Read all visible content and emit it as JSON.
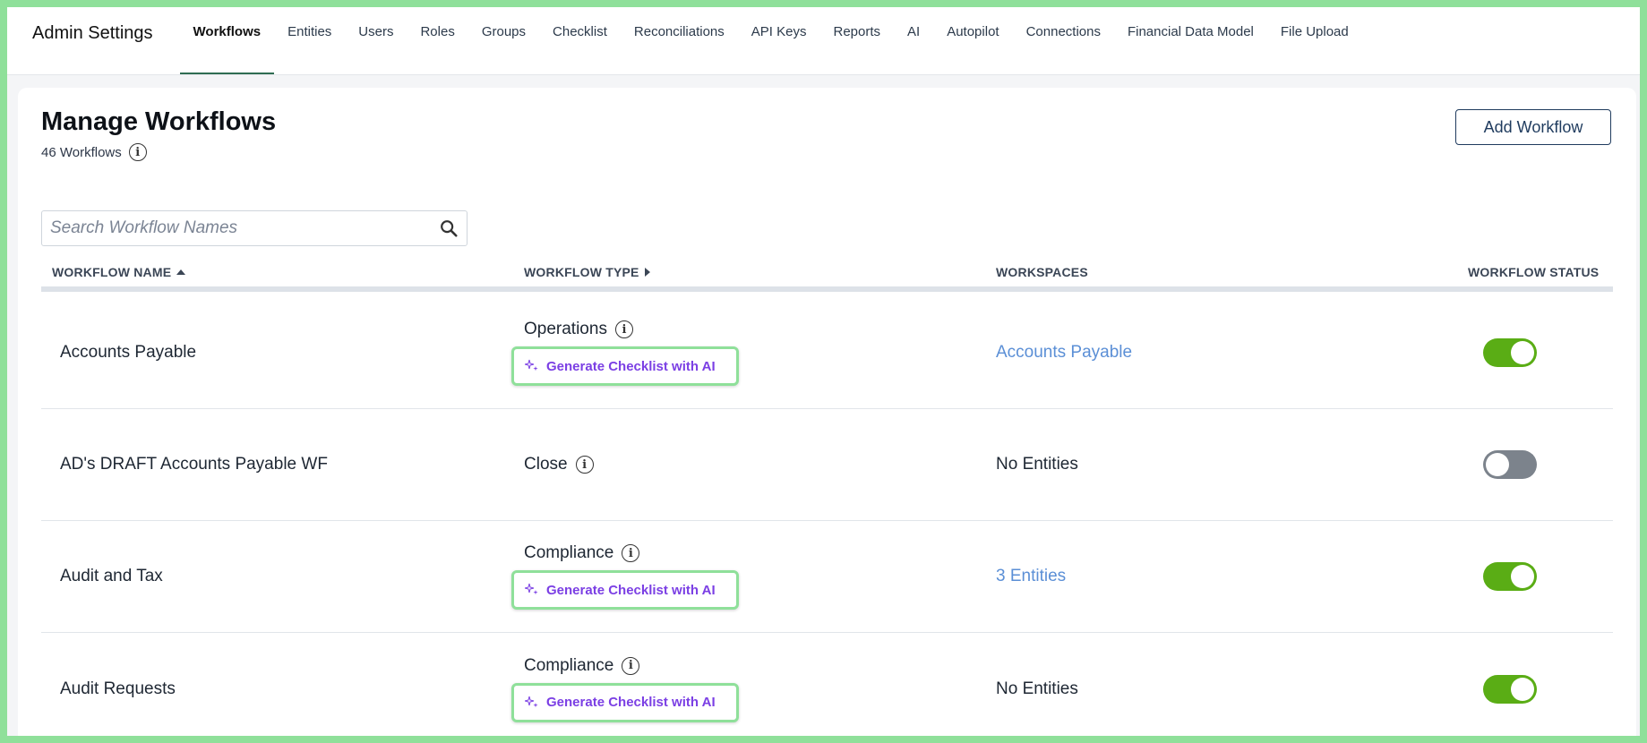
{
  "app": {
    "title": "Admin Settings"
  },
  "nav": {
    "tabs": [
      {
        "label": "Workflows",
        "active": true
      },
      {
        "label": "Entities"
      },
      {
        "label": "Users"
      },
      {
        "label": "Roles"
      },
      {
        "label": "Groups"
      },
      {
        "label": "Checklist"
      },
      {
        "label": "Reconciliations"
      },
      {
        "label": "API Keys"
      },
      {
        "label": "Reports"
      },
      {
        "label": "AI"
      },
      {
        "label": "Autopilot"
      },
      {
        "label": "Connections"
      },
      {
        "label": "Financial Data Model"
      },
      {
        "label": "File Upload"
      }
    ]
  },
  "page": {
    "title": "Manage Workflows",
    "count": "46 Workflows",
    "add_button": "Add Workflow",
    "search_placeholder": "Search Workflow Names"
  },
  "table": {
    "headers": {
      "name": "WORKFLOW NAME",
      "type": "WORKFLOW TYPE",
      "workspaces": "WORKSPACES",
      "status": "WORKFLOW STATUS"
    },
    "ai_button_label": "Generate Checklist with AI",
    "rows": [
      {
        "name": "Accounts Payable",
        "type": "Operations",
        "ai": true,
        "workspace": "Accounts Payable",
        "workspace_link": true,
        "status": true
      },
      {
        "name": "AD's DRAFT Accounts Payable WF",
        "type": "Close",
        "ai": false,
        "workspace": "No Entities",
        "workspace_link": false,
        "status": false
      },
      {
        "name": "Audit and Tax",
        "type": "Compliance",
        "ai": true,
        "workspace": "3 Entities",
        "workspace_link": true,
        "status": true
      },
      {
        "name": "Audit Requests",
        "type": "Compliance",
        "ai": true,
        "workspace": "No Entities",
        "workspace_link": false,
        "status": true
      }
    ]
  },
  "colors": {
    "accent_green": "#5aad15",
    "ai_purple": "#7b3fe4",
    "link_blue": "#5b8fd6",
    "highlight": "#8fe09a"
  }
}
